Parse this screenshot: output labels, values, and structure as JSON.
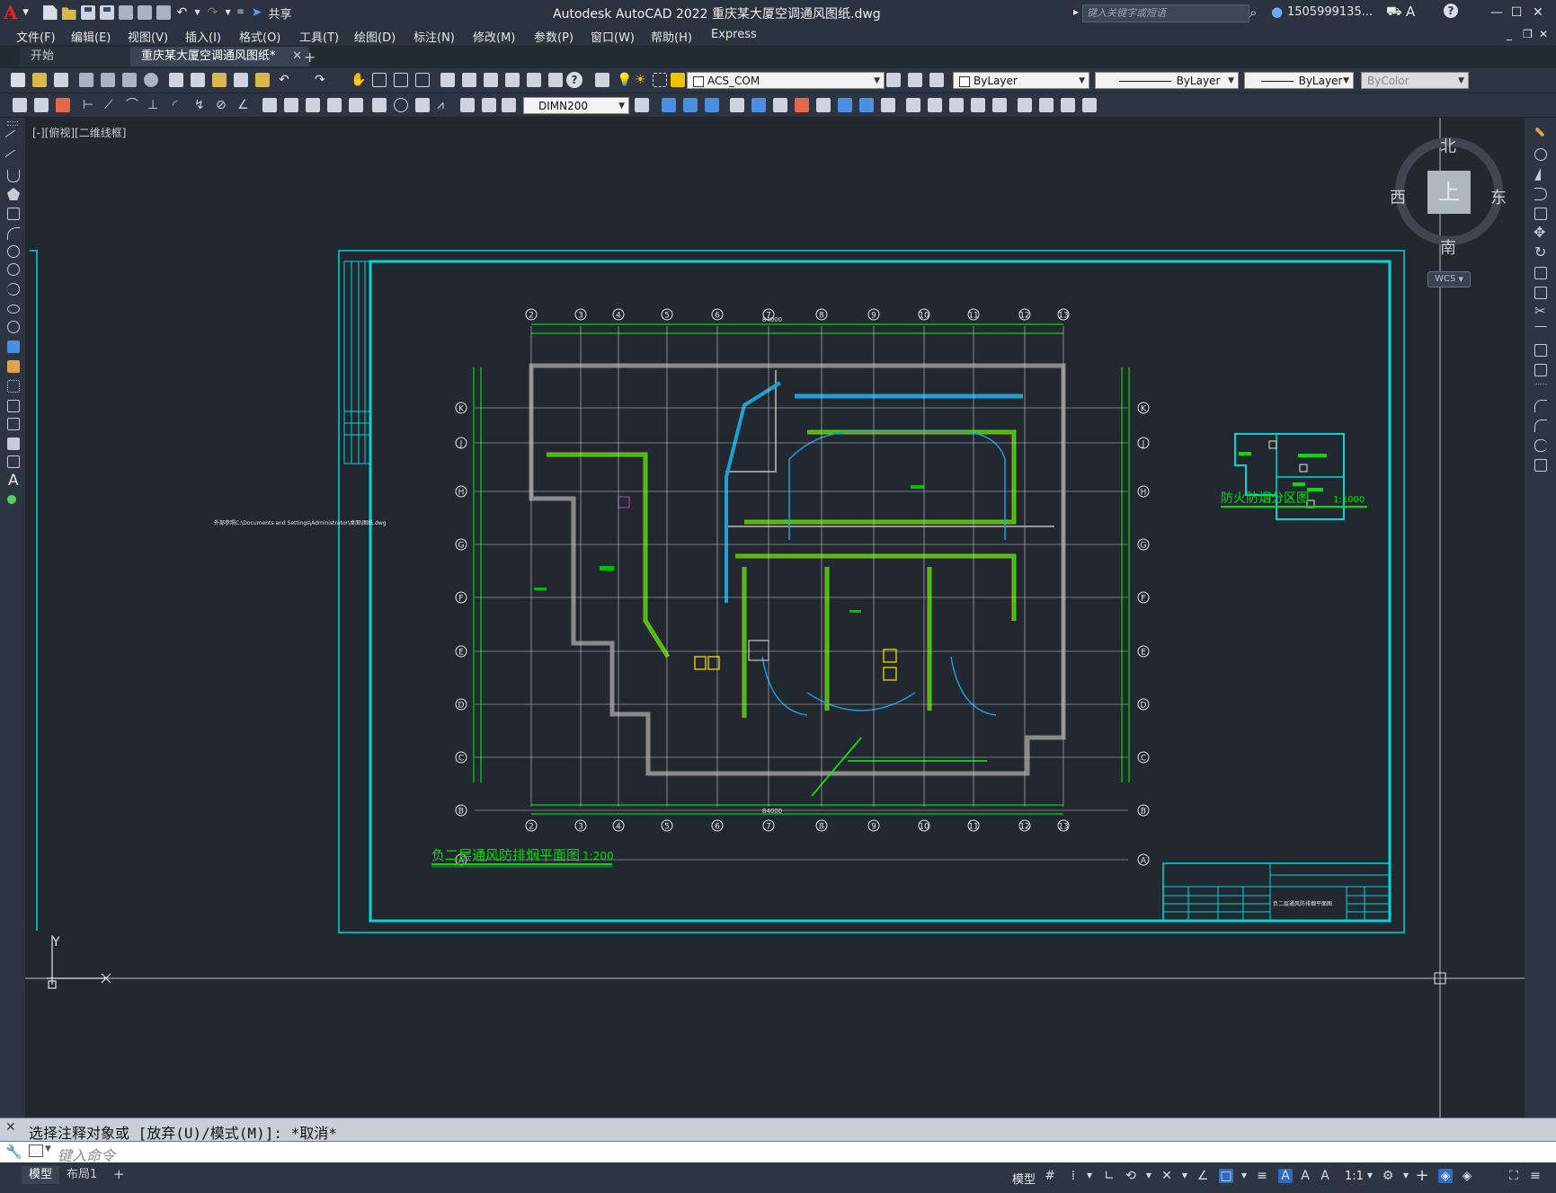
{
  "window": {
    "title": "Autodesk AutoCAD 2022    重庆某大厦空调通风图纸.dwg",
    "share_label": "共享",
    "search_placeholder": "键入关键字或短语",
    "user_name": "1505999135..."
  },
  "menu": [
    "文件(F)",
    "编辑(E)",
    "视图(V)",
    "插入(I)",
    "格式(O)",
    "工具(T)",
    "绘图(D)",
    "标注(N)",
    "修改(M)",
    "参数(P)",
    "窗口(W)",
    "帮助(H)",
    "Express"
  ],
  "tabs": {
    "start": "开始",
    "drawing": "重庆某大厦空调通风图纸*"
  },
  "toolbar": {
    "layer": "ACS_COM",
    "color": "ByLayer",
    "linetype": "ByLayer",
    "lineweight": "ByLayer",
    "plotstyle": "ByColor",
    "dimstyle": "DIMN200"
  },
  "viewport": {
    "label": "[-][俯视][二维线框]"
  },
  "viewcube": {
    "north": "北",
    "south": "南",
    "east": "东",
    "west": "西",
    "face": "上",
    "wcs": "WCS"
  },
  "drawing": {
    "main_title": "负二层通风防排烟平面图",
    "main_scale": "1:200",
    "inset_title": "防火防烟分区图",
    "inset_scale": "1:1000",
    "total_dim": "84000",
    "grid_columns": [
      "2",
      "3",
      "4",
      "5",
      "6",
      "7",
      "8",
      "9",
      "10",
      "11",
      "12",
      "13"
    ],
    "grid_rows": [
      "K",
      "J",
      "H",
      "G",
      "F",
      "E",
      "D",
      "C",
      "B",
      "A"
    ],
    "xref_path": "外部参照C:\\Documents and Settings\\Administrator\\桌面\\图纸.dwg",
    "titleblock_drawing_name": "负二层通风防排烟平面图"
  },
  "ucs": {
    "y_label": "Y"
  },
  "command": {
    "history": "选择注释对象或 [放弃(U)/模式(M)]: *取消*",
    "input_placeholder": "键入命令"
  },
  "layouts": [
    "模型",
    "布局1"
  ],
  "status": {
    "model": "模型",
    "scale": "1:1"
  }
}
